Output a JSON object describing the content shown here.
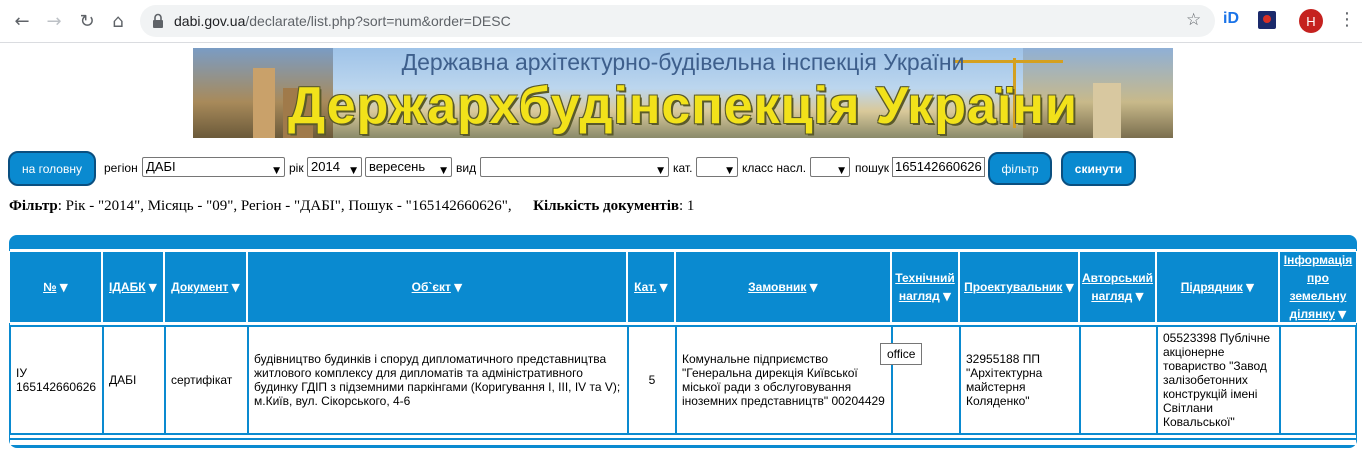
{
  "browser": {
    "url_host": "dabi.gov.ua",
    "url_path": "/declarate/list.php?sort=num&order=DESC",
    "avatar_letter": "H",
    "ext_label": "iD"
  },
  "banner": {
    "subtitle": "Державна архітектурно-будівельна інспекція України",
    "title": "Держархбудінспекція України"
  },
  "filterbar": {
    "home_button": "на головну",
    "region_label": "регіон",
    "region_value": "ДАБІ",
    "year_label": "рік",
    "year_value": "2014",
    "month_value": "вересень",
    "type_label": "вид",
    "type_value": "",
    "cat_label": "кат.",
    "cat_value": "",
    "class_label": "класс насл.",
    "class_value": "",
    "search_label": "пошук",
    "search_value": "165142660626",
    "filter_button": "фільтр",
    "reset_button": "скинути"
  },
  "summary": {
    "filter_label": "Фільтр",
    "filter_text": ": Рік - \"2014\", Місяць - \"09\", Регіон - \"ДАБІ\", Пошук - \"165142660626\",",
    "count_label": "Кількість документів",
    "count_value": ": 1"
  },
  "table": {
    "headers": [
      "№",
      "ІДАБК",
      "Документ",
      "Об`єкт",
      "Кат.",
      "Замовник",
      "Технічний нагляд",
      "Проектувальник",
      "Авторський нагляд",
      "Підрядник",
      "Інформація про земельну ділянку"
    ],
    "row": [
      "ІУ 165142660626",
      "ДАБІ",
      "сертифікат",
      "будівництво будинків і споруд дипломатичного представництва житлового комплексу для дипломатів та адміністративного будинку ГДІП з підземними паркінгами (Коригування І, ІІІ, IV та V); м.Київ, вул. Сікорського, 4-6",
      "5",
      "Комунальне підприємство \"Генеральна дирекція Київської міської ради з обслуговування іноземних представництв\" 00204429",
      "",
      "32955188 ПП \"Архітектурна майстерня Коляденко\"",
      "",
      "05523398 Публічне акціонерне товариство \"Завод залізобетонних конструкцій імені Світлани Ковальської\"",
      ""
    ]
  },
  "tooltip": "office",
  "colors": {
    "accent": "#0a8ad0",
    "banner_title": "#f2e21a"
  }
}
